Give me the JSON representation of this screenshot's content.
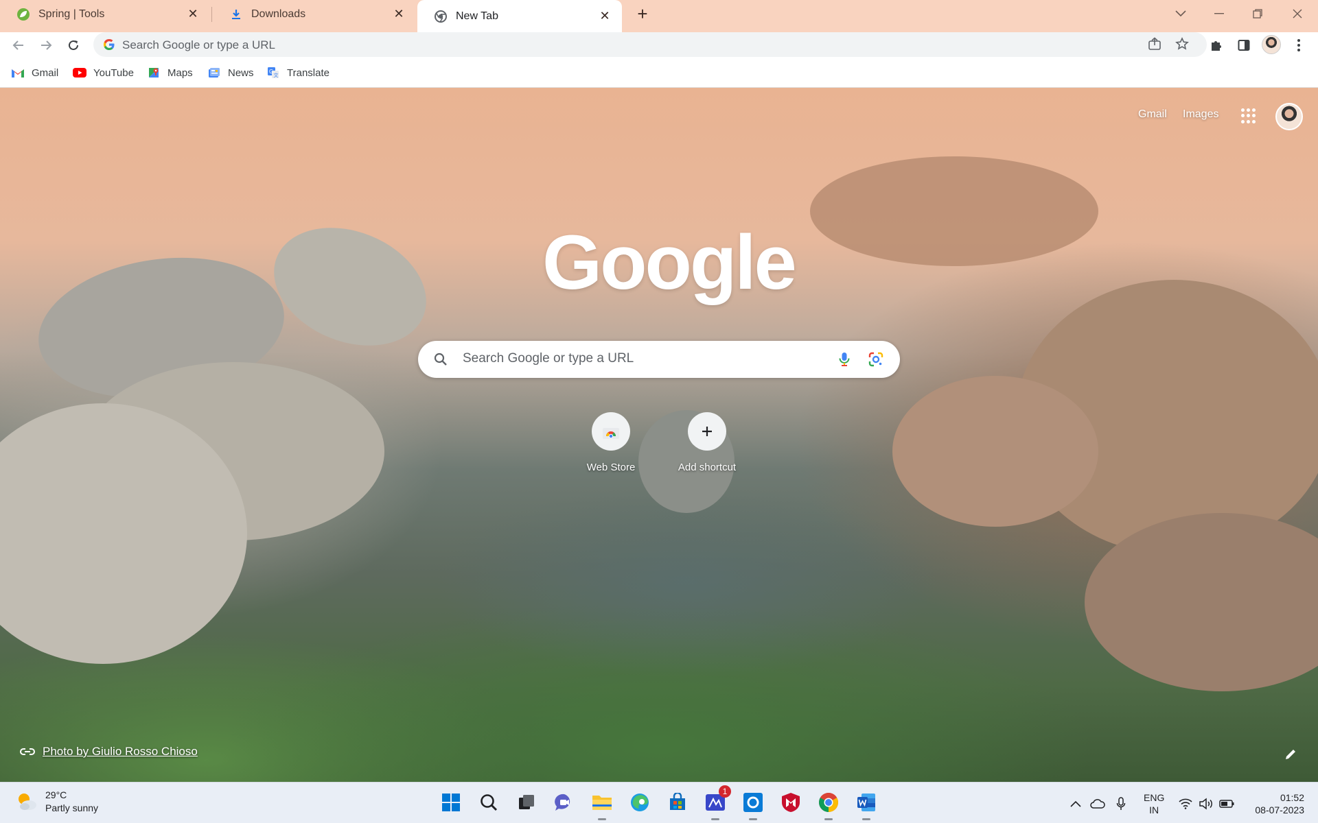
{
  "browser": {
    "tabs": [
      {
        "title": "Spring | Tools",
        "active": false,
        "icon": "spring-leaf-icon"
      },
      {
        "title": "Downloads",
        "active": false,
        "icon": "download-icon"
      },
      {
        "title": "New Tab",
        "active": true,
        "icon": "chrome-icon"
      }
    ],
    "omnibox": {
      "placeholder": "Search Google or type a URL"
    },
    "bookmarks": [
      {
        "label": "Gmail",
        "icon": "gmail-icon"
      },
      {
        "label": "YouTube",
        "icon": "youtube-icon"
      },
      {
        "label": "Maps",
        "icon": "maps-icon"
      },
      {
        "label": "News",
        "icon": "news-icon"
      },
      {
        "label": "Translate",
        "icon": "translate-icon"
      }
    ]
  },
  "ntp": {
    "top_links": {
      "gmail": "Gmail",
      "images": "Images"
    },
    "logo": "Google",
    "search_placeholder": "Search Google or type a URL",
    "shortcuts": [
      {
        "label": "Web Store",
        "icon": "web-store-icon"
      },
      {
        "label": "Add shortcut",
        "icon": "plus-icon"
      }
    ],
    "photo_credit": "Photo by Giulio Rosso Chioso"
  },
  "taskbar": {
    "weather": {
      "temp": "29°C",
      "condition": "Partly sunny"
    },
    "apps": [
      "windows-start-icon",
      "search-icon",
      "task-view-icon",
      "teams-chat-icon",
      "file-explorer-icon",
      "edge-icon",
      "microsoft-store-icon",
      "sketch-app-icon",
      "outlook-icon",
      "mcafee-icon",
      "chrome-icon",
      "word-icon"
    ],
    "notification_badge": "1",
    "language": {
      "line1": "ENG",
      "line2": "IN"
    },
    "clock": {
      "time": "01:52",
      "date": "08-07-2023"
    }
  },
  "colors": {
    "tabstrip": "#f9d3bf",
    "taskbar": "#e9eef6",
    "accent_blue": "#1a73e8"
  }
}
